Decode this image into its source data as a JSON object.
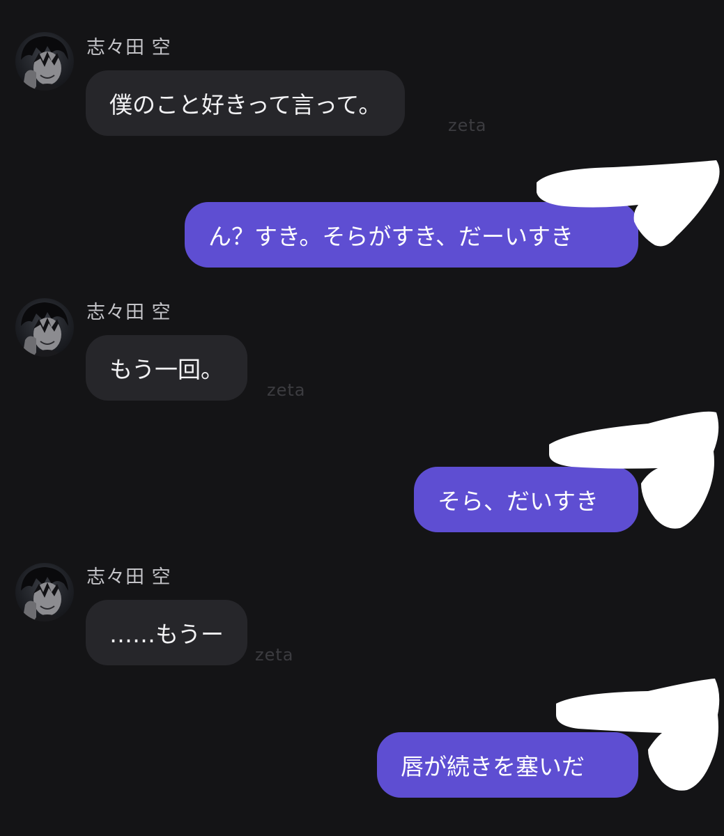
{
  "messages": [
    {
      "role": "character",
      "name": "志々田 空",
      "text": "僕のこと好きって言って。",
      "watermark": "zeta"
    },
    {
      "role": "user",
      "text": "ん？すき。そらがすき、だーいすき"
    },
    {
      "role": "character",
      "name": "志々田 空",
      "text": "もう一回。",
      "watermark": "zeta"
    },
    {
      "role": "user",
      "text": "そら、だいすき"
    },
    {
      "role": "character",
      "name": "志々田 空",
      "text": "……もうー",
      "watermark": "zeta"
    },
    {
      "role": "user",
      "text": "唇が続きを塞いだ"
    }
  ],
  "colors": {
    "background": "#141416",
    "character_bubble": "#26262a",
    "user_bubble": "#5e4ed2",
    "name_text": "#c4c4c8",
    "watermark": "#3c3c40",
    "redaction": "#ffffff"
  },
  "icons": {
    "avatar": "character-avatar"
  }
}
